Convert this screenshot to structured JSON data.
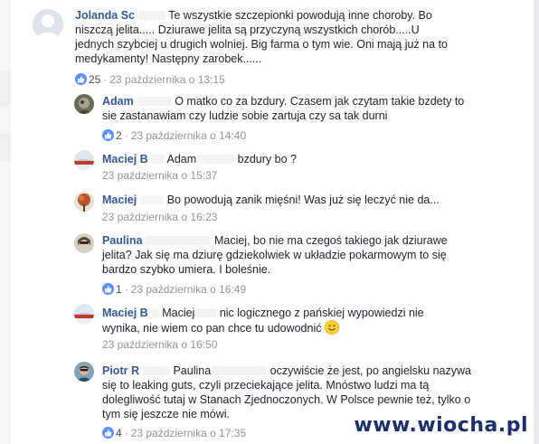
{
  "comments": [
    {
      "author": "Jolanda Sc",
      "text": "Te wszystkie szczepionki powodują inne choroby. Bo niszczą jelita..... Dziurawe jelita są przyczyną wszystkich chorób.....U jednych szybciej u drugich wolniej. Big farma o tym wie. Oni mają już na to medykamenty! Następny zarobek......",
      "reactions": "25",
      "timestamp": "23 października o 13:15"
    },
    {
      "author": "Adam",
      "text": "O matko co za bzdury. Czasem jak czytam takie bzdety to sie zastanawiam czy ludzie sobie zartuja czy sa tak durni",
      "reactions": "2",
      "timestamp": "23 października o 14:40"
    },
    {
      "author": "Maciej B",
      "mention": "Adam",
      "text": "bzdury bo ?",
      "timestamp": "23 października o 15:37"
    },
    {
      "author": "Maciej",
      "text": "Bo powodują zanik mięśni! Was już się leczyć nie da...",
      "timestamp": "23 października o 16:23"
    },
    {
      "author": "Paulina",
      "text": "Maciej, bo nie ma czegoś takiego jak dziurawe jelita? Jak się ma dziurę gdziekolwiek w układzie pokarmowym to się bardzo szybko umiera. I boleśnie.",
      "reactions": "1",
      "timestamp": "23 października o 16:49"
    },
    {
      "author": "Maciej B",
      "mention": "Maciej",
      "text": "nic logicznego z pańskiej wypowiedzi nie wynika, nie wiem co pan chce tu udowodnić",
      "timestamp": "23 października o 16:50"
    },
    {
      "author": "Piotr R",
      "mention": "Paulina",
      "text": "oczywiście że jest, po angielsku nazywa się to leaking guts, czyli przeciekające jelita. Mnóstwo ludzi ma tą dolegliwość tutaj w Stanach Zjednoczonych. W Polsce pewnie też, tylko o tym się jeszcze nie mówi.",
      "reactions": "4",
      "timestamp": "23 października o 17:35"
    }
  ],
  "watermark": "www.wiocha.pl",
  "colors": {
    "author": "#365899",
    "meta": "#90949c",
    "like_badge": "#5890ff"
  },
  "icons": {
    "reaction": "like-thumb-icon",
    "emoji": "smiley-emoji-icon"
  }
}
